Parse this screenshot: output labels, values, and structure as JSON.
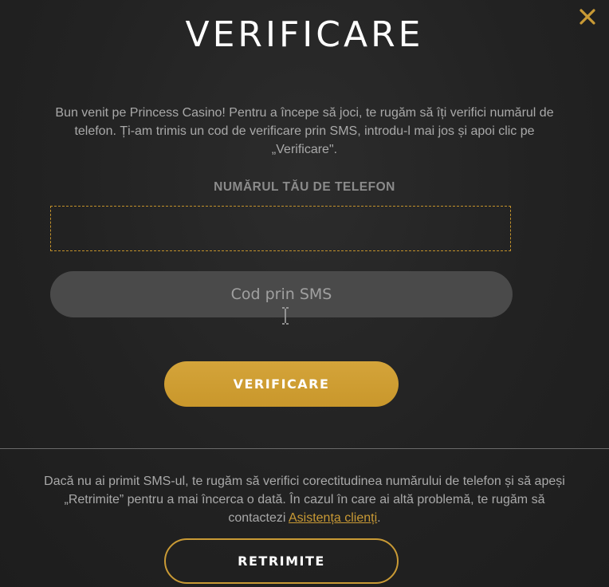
{
  "modal": {
    "title": "VERIFICARE",
    "close_icon": "close-icon",
    "accent_color": "#c99a35"
  },
  "intro": {
    "text": "Bun venit pe Princess Casino! Pentru a începe să joci, te rugăm să îți verifici numărul de telefon. Ți-am trimis un cod de verificare prin SMS, introdu-l mai jos și apoi clic pe „Verificare\"."
  },
  "phone": {
    "label": "NUMĂRUL TĂU DE TELEFON",
    "value": ""
  },
  "sms": {
    "placeholder": "Cod prin SMS"
  },
  "verify_button": {
    "label": "VERIFICARE"
  },
  "help": {
    "text_before": "Dacă nu ai primit SMS-ul, te rugăm să verifici corectitudinea numărului de telefon și să apeși „Retrimite” pentru a mai încerca o dată. În cazul în care ai altă problemă, te rugăm să contactezi ",
    "link_label": "Asistența clienți",
    "text_after": "."
  },
  "resend_button": {
    "label": "RETRIMITE"
  }
}
